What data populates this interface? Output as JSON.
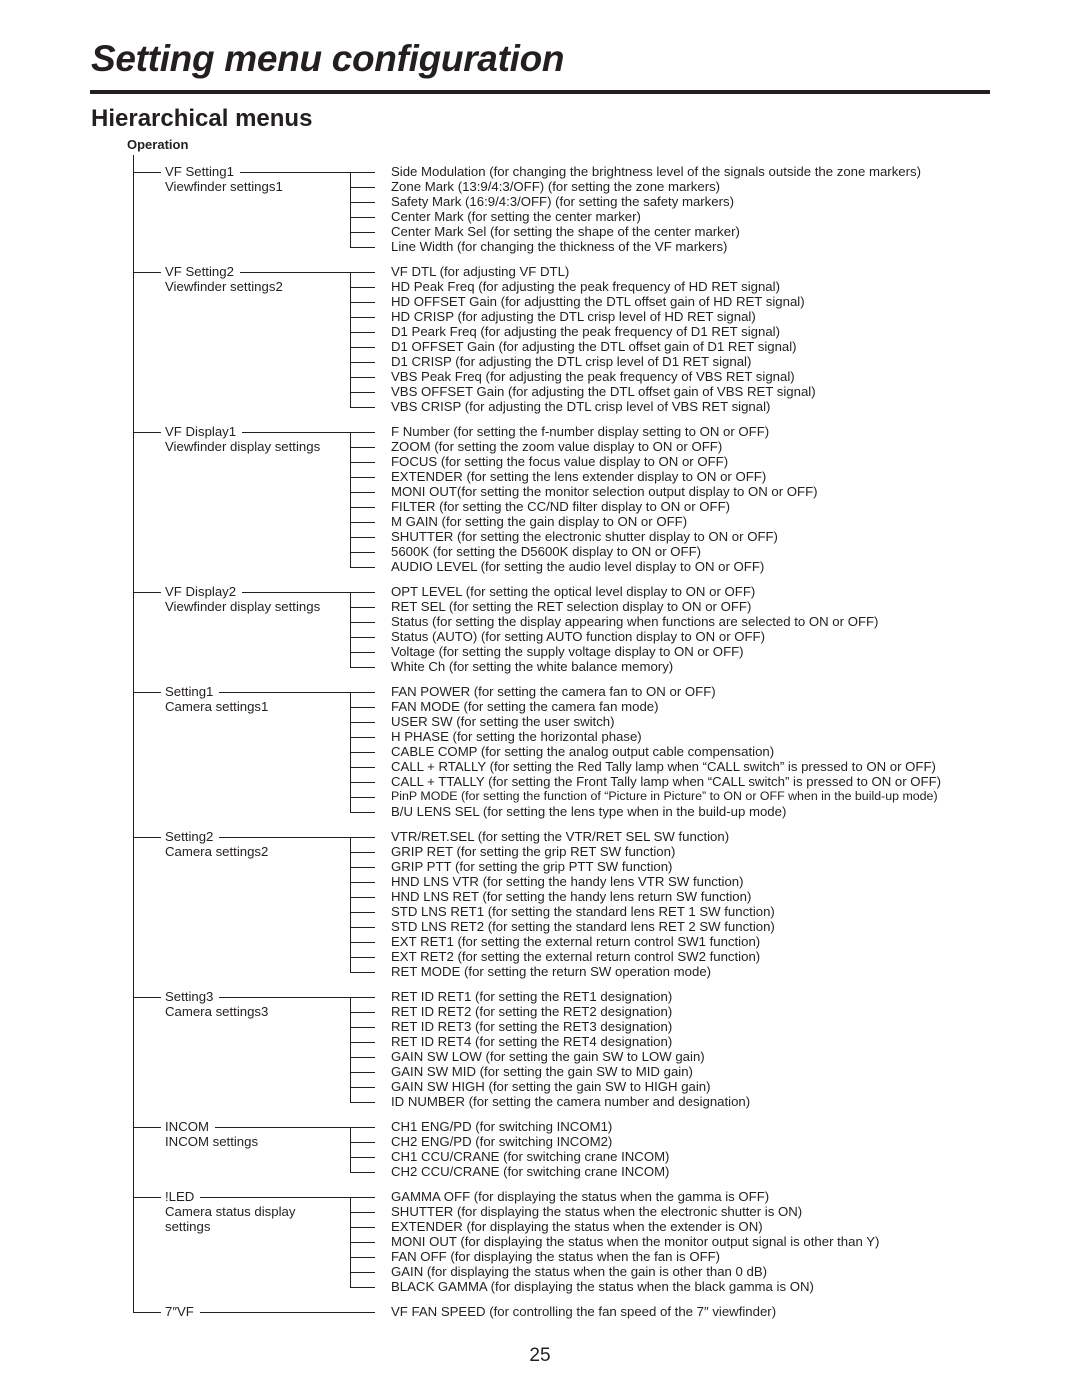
{
  "page": {
    "title": "Setting menu configuration",
    "subtitle": "Hierarchical menus",
    "root_label": "Operation",
    "page_number": "25"
  },
  "groups": [
    {
      "name": "VF Setting1",
      "desc": [
        "Viewfinder settings1"
      ],
      "items": [
        "Side Modulation (for changing the brightness level of the signals outside the zone markers)",
        "Zone Mark (13:9/4:3/OFF) (for setting the zone markers)",
        "Safety Mark (16:9/4:3/OFF) (for setting the safety markers)",
        "Center Mark (for setting the center marker)",
        "Center Mark Sel (for setting the shape of the center marker)",
        "Line Width (for changing the thickness of the VF markers)"
      ]
    },
    {
      "name": "VF Setting2",
      "desc": [
        "Viewfinder settings2"
      ],
      "items": [
        "VF DTL (for adjusting VF DTL)",
        "HD Peak Freq (for adjusting the peak frequency of HD RET signal)",
        "HD OFFSET Gain (for adjustting the DTL offset gain of HD RET signal)",
        "HD CRISP (for adjusting the DTL crisp level of HD RET signal)",
        "D1 Peark Freq (for adjusting the peak frequency of D1 RET signal)",
        "D1 OFFSET Gain (for adjusting the DTL offset gain of D1 RET signal)",
        "D1 CRISP (for adjusting the DTL crisp level of D1 RET signal)",
        "VBS Peak Freq (for adjusting the peak frequency of VBS RET signal)",
        "VBS OFFSET Gain (for adjusting the DTL offset gain of VBS RET signal)",
        "VBS CRISP (for adjusting the DTL crisp level of VBS RET signal)"
      ]
    },
    {
      "name": "VF Display1",
      "desc": [
        "Viewfinder display settings"
      ],
      "items": [
        "F Number (for setting the f-number display setting to ON or OFF)",
        "ZOOM (for setting the zoom value display to ON or OFF)",
        "FOCUS (for setting the focus value display to ON or OFF)",
        "EXTENDER (for setting the lens extender display to ON or OFF)",
        "MONI OUT(for setting the monitor selection output display to ON or OFF)",
        "FILTER (for setting the CC/ND filter display to ON or OFF)",
        "M GAIN (for setting the gain display to ON or OFF)",
        "SHUTTER (for setting the electronic shutter display to ON or OFF)",
        "5600K (for setting the D5600K display to ON or OFF)",
        "AUDIO LEVEL (for setting the audio level display to ON or OFF)"
      ]
    },
    {
      "name": "VF Display2",
      "desc": [
        "Viewfinder display settings"
      ],
      "items": [
        "OPT LEVEL (for setting the optical level display to ON or OFF)",
        "RET SEL (for setting the RET selection display to ON or OFF)",
        "Status (for setting the display appearing when functions are selected to ON or OFF)",
        "Status (AUTO) (for setting AUTO function display to ON or OFF)",
        "Voltage (for setting the supply voltage display to ON or OFF)",
        "White Ch (for setting the white balance memory)"
      ]
    },
    {
      "name": "Setting1",
      "desc": [
        "Camera settings1"
      ],
      "items": [
        "FAN POWER (for setting the camera fan to ON or OFF)",
        "FAN MODE (for setting the camera fan mode)",
        "USER SW (for setting the user switch)",
        "H PHASE (for setting the horizontal phase)",
        "CABLE COMP (for setting the analog output cable compensation)",
        "CALL + RTALLY (for setting the Red Tally lamp when “CALL switch” is pressed to ON or OFF)",
        "CALL + TTALLY (for setting the Front Tally lamp when “CALL switch” is pressed to ON or OFF)",
        "PinP MODE (for setting the function of “Picture in Picture” to ON or OFF when in the build-up mode)",
        "B/U LENS SEL (for setting the lens type when in the build-up mode)"
      ]
    },
    {
      "name": "Setting2",
      "desc": [
        "Camera settings2"
      ],
      "items": [
        "VTR/RET.SEL (for setting the VTR/RET SEL SW function)",
        "GRIP RET (for setting the grip RET SW function)",
        "GRIP PTT (for setting the grip PTT SW function)",
        "HND LNS VTR (for setting the handy lens VTR SW function)",
        "HND LNS RET (for setting the handy lens return SW function)",
        "STD LNS RET1 (for setting the standard lens RET 1 SW function)",
        "STD LNS RET2 (for setting the standard lens RET 2 SW function)",
        "EXT RET1 (for setting the external return control SW1 function)",
        "EXT RET2 (for setting the external return control SW2 function)",
        "RET MODE (for setting the return SW operation mode)"
      ]
    },
    {
      "name": "Setting3",
      "desc": [
        "Camera settings3"
      ],
      "items": [
        "RET ID RET1 (for setting the RET1 designation)",
        "RET ID RET2 (for setting the RET2 designation)",
        "RET ID RET3 (for setting the RET3 designation)",
        "RET ID RET4 (for setting the RET4 designation)",
        "GAIN SW LOW (for setting the gain SW to LOW gain)",
        "GAIN SW MID (for setting the gain SW to MID gain)",
        "GAIN SW HIGH (for setting the gain SW to HIGH gain)",
        "ID NUMBER (for setting the camera number and designation)"
      ]
    },
    {
      "name": "INCOM",
      "desc": [
        "INCOM settings"
      ],
      "items": [
        "CH1 ENG/PD (for switching INCOM1)",
        "CH2 ENG/PD (for switching INCOM2)",
        "CH1 CCU/CRANE (for switching crane INCOM)",
        "CH2 CCU/CRANE (for switching crane INCOM)"
      ]
    },
    {
      "name": "!LED",
      "desc": [
        "Camera status display",
        "settings"
      ],
      "items": [
        "GAMMA OFF (for displaying the status when the gamma is OFF)",
        "SHUTTER (for displaying the status when the electronic shutter is ON)",
        "EXTENDER (for displaying the status when the extender is ON)",
        "MONI OUT (for displaying the status when the monitor output signal is other than Y)",
        "FAN OFF (for displaying the status when the fan is OFF)",
        "GAIN (for displaying the status when the gain is other than 0 dB)",
        "BLACK GAMMA (for displaying the status when the black gamma is ON)"
      ]
    },
    {
      "name": "7″VF",
      "desc": [],
      "items": [
        "VF FAN SPEED (for controlling the fan speed of the 7″ viewfinder)"
      ]
    }
  ]
}
